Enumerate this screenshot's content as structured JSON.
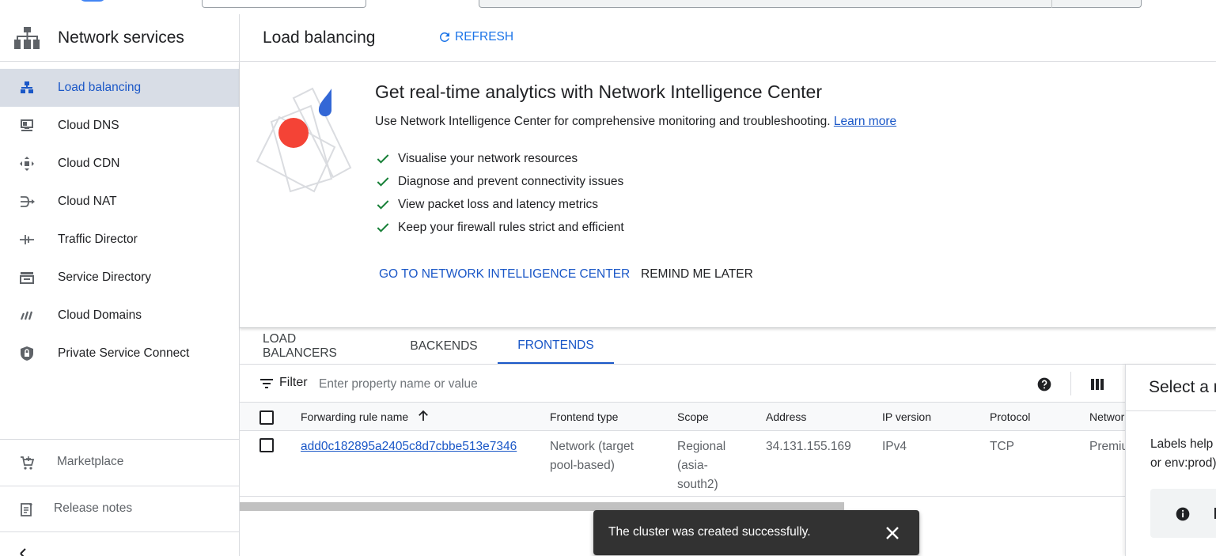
{
  "sidebar": {
    "title": "Network services",
    "items": [
      {
        "label": "Load balancing",
        "icon": "load-balancing-icon",
        "active": true
      },
      {
        "label": "Cloud DNS",
        "icon": "cloud-dns-icon",
        "active": false
      },
      {
        "label": "Cloud CDN",
        "icon": "cloud-cdn-icon",
        "active": false
      },
      {
        "label": "Cloud NAT",
        "icon": "cloud-nat-icon",
        "active": false
      },
      {
        "label": "Traffic Director",
        "icon": "traffic-director-icon",
        "active": false
      },
      {
        "label": "Service Directory",
        "icon": "service-directory-icon",
        "active": false
      },
      {
        "label": "Cloud Domains",
        "icon": "cloud-domains-icon",
        "active": false
      },
      {
        "label": "Private Service Connect",
        "icon": "private-service-connect-icon",
        "active": false
      }
    ],
    "footer": [
      {
        "label": "Marketplace",
        "icon": "marketplace-cart-icon"
      },
      {
        "label": "Release notes",
        "icon": "release-notes-icon"
      }
    ]
  },
  "header": {
    "title": "Load balancing",
    "refresh_label": "REFRESH"
  },
  "banner": {
    "title": "Get real-time analytics with Network Intelligence Center",
    "description": "Use Network Intelligence Center for comprehensive monitoring and troubleshooting.",
    "learn_more": "Learn more",
    "checks": [
      "Visualise your network resources",
      "Diagnose and prevent connectivity issues",
      "View packet loss and latency metrics",
      "Keep your firewall rules strict and efficient"
    ],
    "primary_button": "GO TO NETWORK INTELLIGENCE CENTER",
    "secondary_button": "REMIND ME LATER"
  },
  "tabs": [
    {
      "label": "LOAD BALANCERS",
      "active": false
    },
    {
      "label": "BACKENDS",
      "active": false
    },
    {
      "label": "FRONTENDS",
      "active": true
    }
  ],
  "filter": {
    "label": "Filter",
    "placeholder": "Enter property name or value"
  },
  "table": {
    "columns": [
      "Forwarding rule name",
      "Frontend type",
      "Scope",
      "Address",
      "IP version",
      "Protocol",
      "Network Tier"
    ],
    "rows": [
      {
        "name": "add0c182895a2405c8d7cbbe513e7346",
        "frontend_type_line1": "Network (target",
        "frontend_type_line2": "pool-based)",
        "scope_line1": "Regional",
        "scope_line2": "(asia-",
        "scope_line3": "south2)",
        "address": "34.131.155.169",
        "ip_version": "IPv4",
        "protocol": "TCP",
        "network_tier": "Premium"
      }
    ]
  },
  "right_panel": {
    "title": "Select a resource",
    "text_line1": "Labels help organize your resources",
    "text_line2": "or env:prod)"
  },
  "toast": {
    "message": "The cluster was created successfully."
  },
  "colors": {
    "accent": "#1a57c7",
    "active_nav_bg": "#d8dde6",
    "check_green": "#188038",
    "toast_bg": "#323232"
  }
}
